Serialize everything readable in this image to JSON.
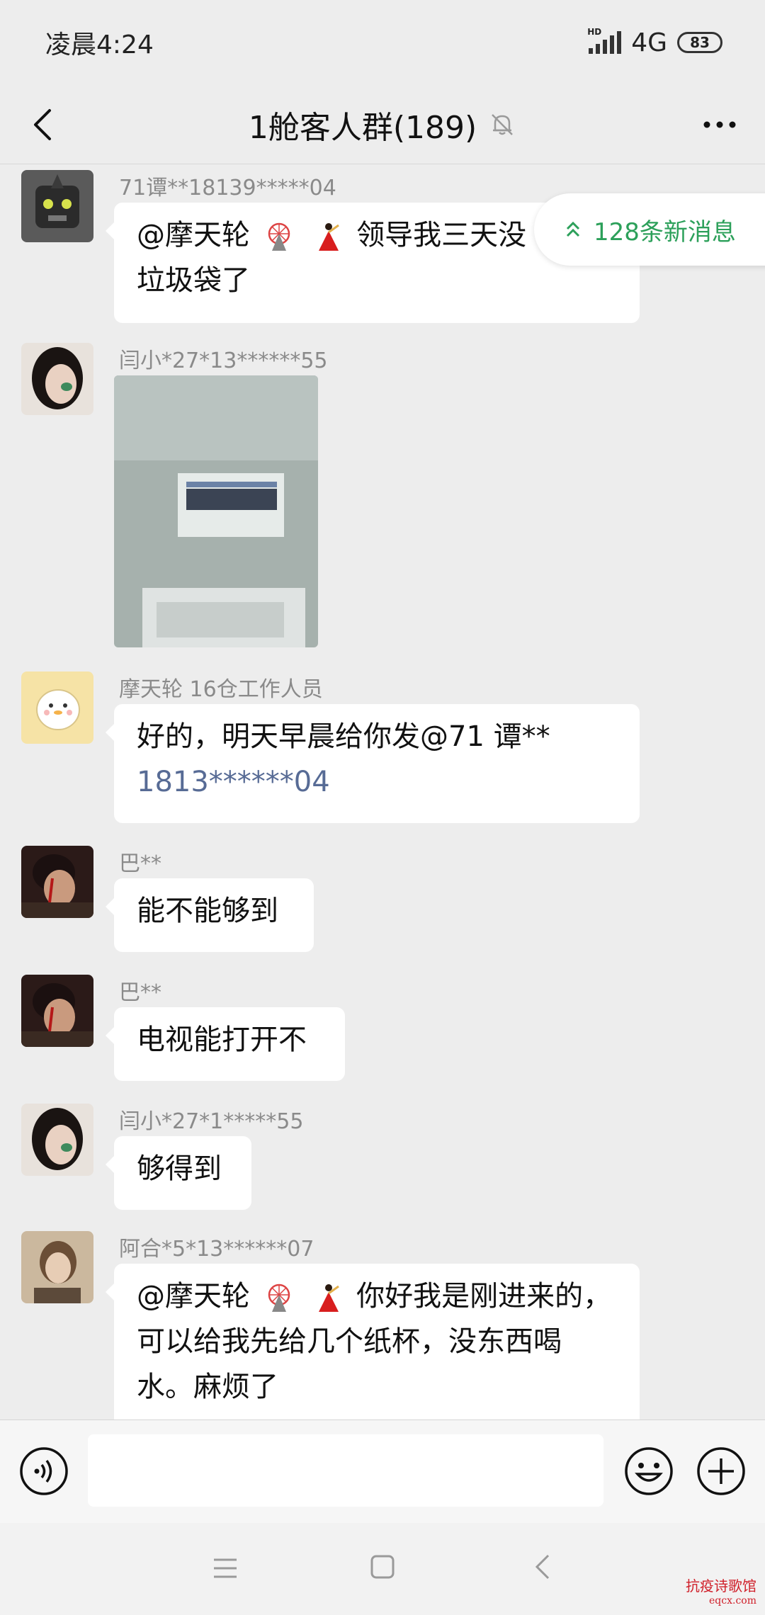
{
  "status_bar": {
    "time": "凌晨4:24",
    "hd": "HD",
    "network": "4G",
    "battery": "83"
  },
  "header": {
    "title": "1舱客人群(189)"
  },
  "new_messages": "128条新消息",
  "messages": [
    {
      "sender": "71谭**18139*****04",
      "lines": [
        "@摩天轮",
        "领导我三天没",
        "垃圾袋了"
      ]
    },
    {
      "sender": "闫小*27*13******55"
    },
    {
      "sender": "摩天轮",
      "sender_suffix": "16仓工作人员",
      "text": "好的，明天早晨给你发@71 谭**",
      "link": "1813******04"
    },
    {
      "sender": "巴**",
      "text": "能不能够到"
    },
    {
      "sender": "巴**",
      "text": "电视能打开不"
    },
    {
      "sender": "闫小*27*1*****55",
      "text": "够得到"
    },
    {
      "sender": "阿合*5*13******07",
      "lines": [
        "@摩天轮",
        "你好我是刚进来的，",
        "可以给我先给几个纸杯，没东西喝",
        "水。麻烦了"
      ]
    }
  ],
  "watermark": {
    "line1": "抗疫诗歌馆",
    "line2": "eqcx.com"
  },
  "colors": {
    "bg": "#ededed",
    "accent_green": "#2ca05a",
    "link": "#576b95"
  }
}
